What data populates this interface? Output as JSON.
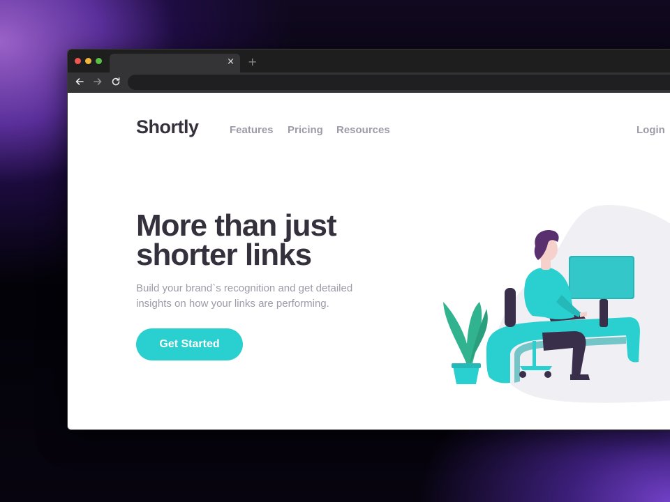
{
  "browser": {
    "tab_close": "×",
    "new_tab": "+"
  },
  "site": {
    "logo": "Shortly",
    "nav": [
      "Features",
      "Pricing",
      "Resources"
    ],
    "login": "Login"
  },
  "hero": {
    "title_line1": "More than just",
    "title_line2": "shorter links",
    "subtitle": "Build your brand`s recognition and get detailed insights on how your links are performing.",
    "cta": "Get Started"
  },
  "colors": {
    "accent": "#2acfcf",
    "heading": "#34313d",
    "muted": "#9e9aa8",
    "blob": "#efeff4"
  }
}
